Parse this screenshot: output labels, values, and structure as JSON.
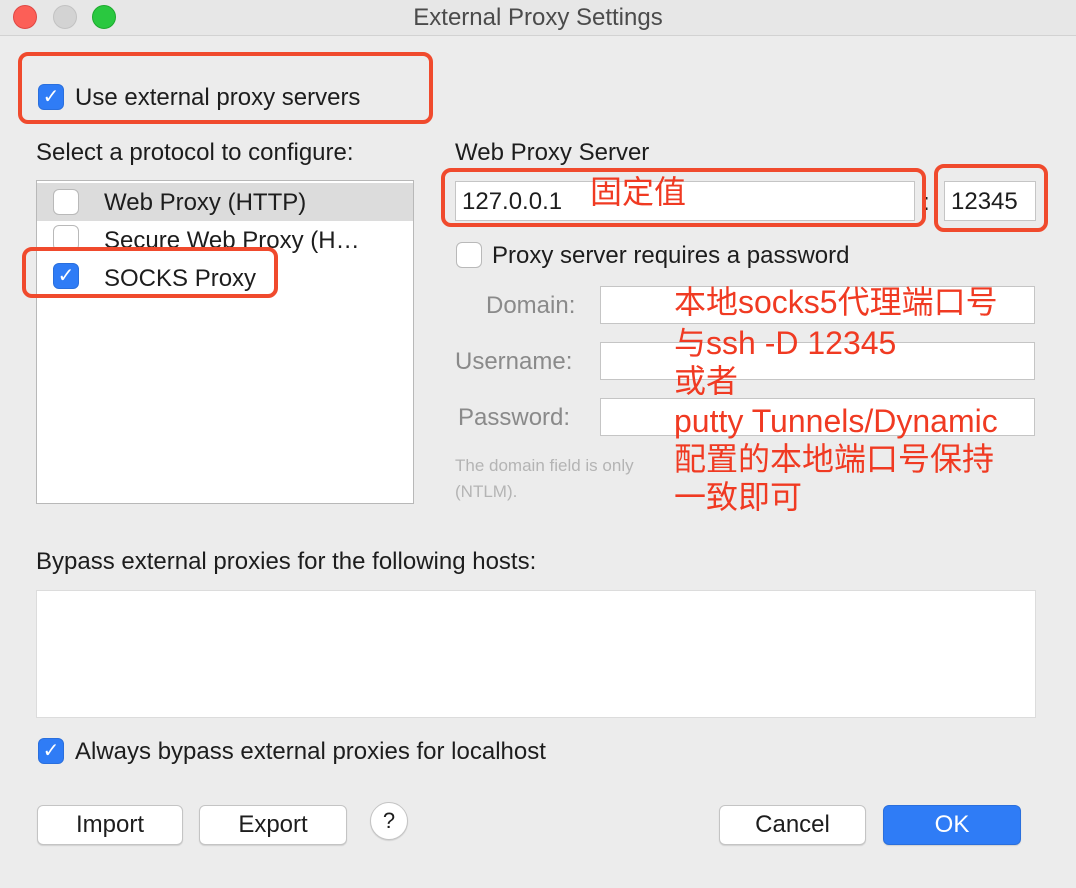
{
  "window": {
    "title": "External Proxy Settings"
  },
  "use_external": {
    "label": "Use external proxy servers",
    "checked": true
  },
  "protocol": {
    "heading": "Select a protocol to configure:",
    "items": [
      {
        "label": "Web Proxy (HTTP)",
        "checked": false,
        "selected": true
      },
      {
        "label": "Secure Web Proxy (H…",
        "checked": false,
        "selected": false
      },
      {
        "label": "SOCKS Proxy",
        "checked": true,
        "selected": false
      }
    ]
  },
  "server": {
    "heading": "Web Proxy Server",
    "host": "127.0.0.1",
    "separator": ":",
    "port": "12345",
    "requires_password": "Proxy server requires a password",
    "domain_label": "Domain:",
    "username_label": "Username:",
    "password_label": "Password:",
    "hint_line1": "The domain field is only",
    "hint_line2": "(NTLM)."
  },
  "bypass": {
    "heading": "Bypass external proxies for the following hosts:",
    "always_label": "Always bypass external proxies for localhost",
    "always_checked": true
  },
  "buttons": {
    "import": "Import",
    "export": "Export",
    "help": "?",
    "cancel": "Cancel",
    "ok": "OK"
  },
  "annotations": {
    "fixed_value": "固定值",
    "lines": [
      "本地socks5代理端口号",
      "与ssh -D 12345",
      "或者",
      "putty Tunnels/Dynamic",
      "配置的本地端口号保持",
      "一致即可"
    ]
  },
  "colors": {
    "accent": "#2f7cf6",
    "annotation": "#f03a22"
  }
}
